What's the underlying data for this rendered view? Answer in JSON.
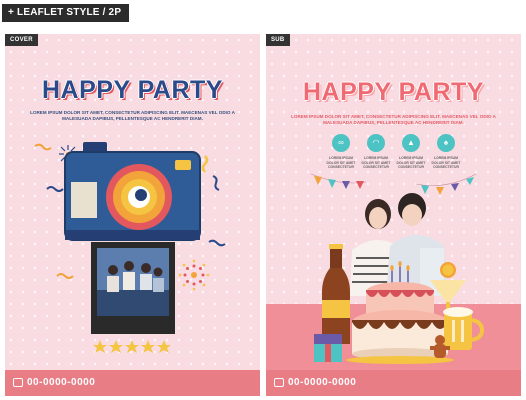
{
  "header": {
    "label": "+ LEAFLET STYLE / 2P"
  },
  "cover": {
    "tag": "COVER",
    "title": "HAPPY PARTY",
    "body": "LOREM IPSUM DOLOR SIT AMET, CONSECTETUR ADIPISCING ELIT. MAECENAS VEL ODIO A MALESUADA DAPIBUS, PELLENTESQUE AC HENDRERIT DIAM.",
    "phone": "00-0000-0000"
  },
  "sub": {
    "tag": "SUB",
    "title": "HAPPY PARTY",
    "body": "LOREM IPSUM DOLOR SIT AMET, CONSECTETUR ADIPISCING ELIT. MAECENAS VEL ODIO A MALESUADA DAPIBUS, PELLENTESQUE AC HENDRERIT DIAM.",
    "icons": [
      {
        "icon": "glasses-icon",
        "lines": [
          "LOREM IPSUM",
          "DOLOR SIT AMET",
          "CONSECTETUR"
        ]
      },
      {
        "icon": "mask-icon",
        "lines": [
          "LOREM IPSUM",
          "DOLOR SIT AMET",
          "CONSECTETUR"
        ]
      },
      {
        "icon": "cake-icon",
        "lines": [
          "LOREM IPSUM",
          "DOLOR SIT AMET",
          "CONSECTETUR"
        ]
      },
      {
        "icon": "cards-icon",
        "lines": [
          "LOREM IPSUM",
          "DOLOR SIT AMET",
          "CONSECTETUR"
        ]
      }
    ],
    "phone": "00-0000-0000"
  },
  "colors": {
    "accent_navy": "#2c4a8a",
    "accent_coral": "#ef6a72",
    "teal": "#4ec3c4",
    "pink_bg": "#f9dbe2",
    "footer": "#e97d86"
  }
}
